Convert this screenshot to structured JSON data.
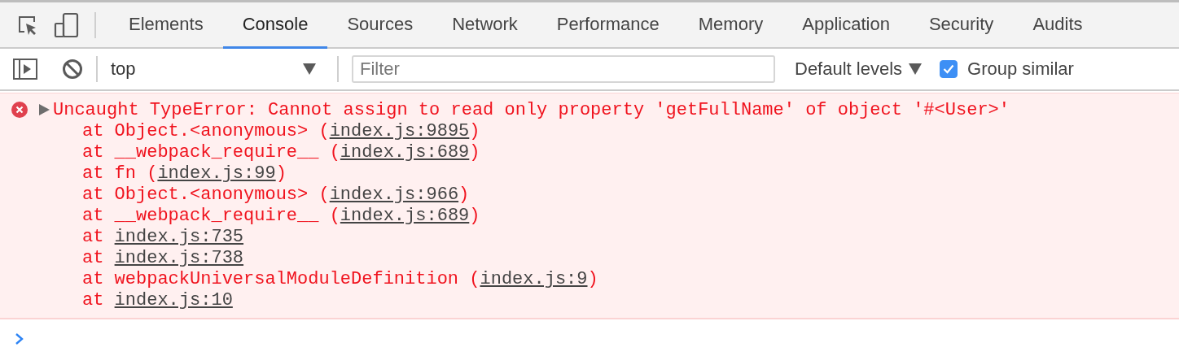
{
  "tabs": [
    {
      "label": "Elements",
      "selected": false
    },
    {
      "label": "Console",
      "selected": true
    },
    {
      "label": "Sources",
      "selected": false
    },
    {
      "label": "Network",
      "selected": false
    },
    {
      "label": "Performance",
      "selected": false
    },
    {
      "label": "Memory",
      "selected": false
    },
    {
      "label": "Application",
      "selected": false
    },
    {
      "label": "Security",
      "selected": false
    },
    {
      "label": "Audits",
      "selected": false
    }
  ],
  "toolbar": {
    "context": "top",
    "filter": {
      "placeholder": "Filter"
    },
    "levels": "Default levels",
    "group_similar": {
      "label": "Group similar",
      "checked": true
    }
  },
  "messages": [
    {
      "kind": "error",
      "expanded": false,
      "text": "Uncaught TypeError: Cannot assign to read only property 'getFullName' of object '#<User>'",
      "stack": [
        {
          "pre": "at Object.<anonymous> (",
          "link": "index.js:9895",
          "post": ")"
        },
        {
          "pre": "at __webpack_require__ (",
          "link": "index.js:689",
          "post": ")"
        },
        {
          "pre": "at fn (",
          "link": "index.js:99",
          "post": ")"
        },
        {
          "pre": "at Object.<anonymous> (",
          "link": "index.js:966",
          "post": ")"
        },
        {
          "pre": "at __webpack_require__ (",
          "link": "index.js:689",
          "post": ")"
        },
        {
          "pre": "at ",
          "link": "index.js:735"
        },
        {
          "pre": "at ",
          "link": "index.js:738"
        },
        {
          "pre": "at webpackUniversalModuleDefinition (",
          "link": "index.js:9",
          "post": ")"
        },
        {
          "pre": "at ",
          "link": "index.js:10"
        }
      ]
    }
  ]
}
